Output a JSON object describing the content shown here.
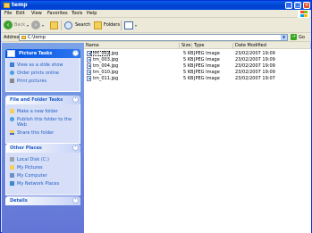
{
  "window": {
    "title": "temp"
  },
  "menu": [
    "File",
    "Edit",
    "View",
    "Favorites",
    "Tools",
    "Help"
  ],
  "toolbar": {
    "back_label": "Back",
    "search_label": "Search",
    "folders_label": "Folders"
  },
  "address": {
    "label": "Address",
    "value": "C:\\temp",
    "go_label": "Go"
  },
  "panels": {
    "picture_tasks": {
      "title": "Picture Tasks",
      "items": [
        "View as a slide show",
        "Order prints online",
        "Print pictures"
      ]
    },
    "file_folder_tasks": {
      "title": "File and Folder Tasks",
      "items": [
        "Make a new folder",
        "Publish this folder to the",
        "Web",
        "Share this folder"
      ]
    },
    "other_places": {
      "title": "Other Places",
      "items": [
        "Local Disk (C:)",
        "My Pictures",
        "My Computer",
        "My Network Places"
      ]
    },
    "details": {
      "title": "Details"
    }
  },
  "columns": [
    "Name",
    "Size",
    "Type",
    "Date Modified"
  ],
  "files": [
    {
      "name": "tm_002.jpg",
      "size": "5 KB",
      "type": "JPEG Image",
      "date": "23/02/2007 19:09"
    },
    {
      "name": "tm_003.jpg",
      "size": "5 KB",
      "type": "JPEG Image",
      "date": "23/02/2007 19:09"
    },
    {
      "name": "tm_004.jpg",
      "size": "5 KB",
      "type": "JPEG Image",
      "date": "23/02/2007 19:09"
    },
    {
      "name": "tm_010.jpg",
      "size": "5 KB",
      "type": "JPEG Image",
      "date": "23/02/2007 19:09"
    },
    {
      "name": "tm_011.jpg",
      "size": "5 KB",
      "type": "JPEG Image",
      "date": "23/02/2007 19:07"
    }
  ]
}
